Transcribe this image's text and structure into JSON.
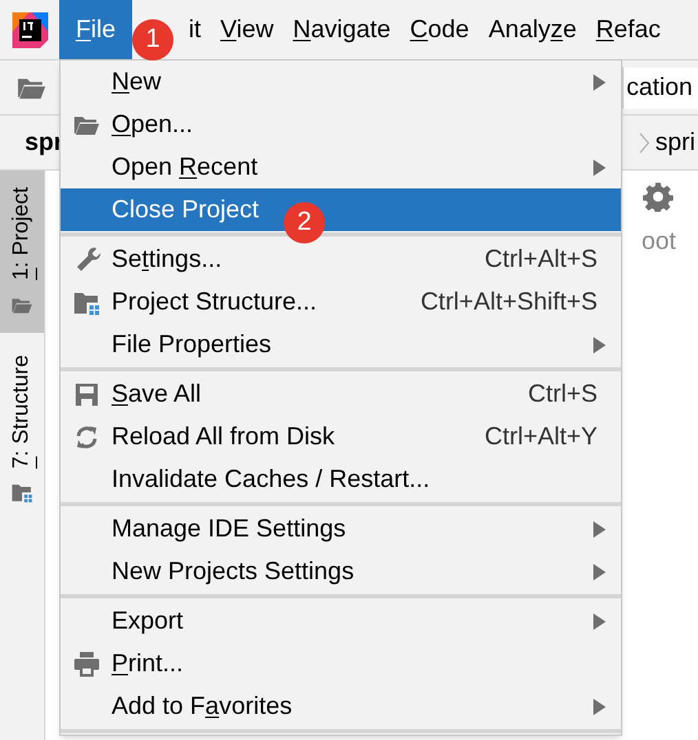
{
  "menu_bar": [
    {
      "label": {
        "key": "F",
        "after": "ile"
      },
      "selected": true
    },
    {
      "label": "it",
      "selected": false
    },
    {
      "label": {
        "key": "V",
        "after": "iew"
      },
      "selected": false
    },
    {
      "label": {
        "key": "N",
        "after": "avigate"
      },
      "selected": false
    },
    {
      "label": {
        "key": "C",
        "after": "ode"
      },
      "selected": false
    },
    {
      "label": {
        "before": "Analy",
        "key": "z",
        "after": "e"
      },
      "selected": false
    },
    {
      "label": {
        "key": "R",
        "after": "efac"
      },
      "selected": false
    }
  ],
  "toolbar": {
    "field_value": "cation"
  },
  "navigation_bar": {
    "project": "spr",
    "breadcrumb": "spri"
  },
  "tool_window_tabs": [
    {
      "label": {
        "key": "1",
        "after": ": Project"
      },
      "selected": true
    },
    {
      "label": {
        "key": "7",
        "after": ": Structure"
      },
      "selected": false
    }
  ],
  "editor": {
    "text": "oot"
  },
  "file_menu": [
    {
      "kind": "plain",
      "label": {
        "key": "N",
        "after": "ew"
      },
      "has_submenu": true,
      "selected": false
    },
    {
      "kind": "folder",
      "label": {
        "key": "O",
        "after": "pen..."
      },
      "has_submenu": false,
      "selected": false
    },
    {
      "kind": "plain",
      "label": {
        "before": "Open ",
        "key": "R",
        "after": "ecent"
      },
      "has_submenu": true,
      "selected": false
    },
    {
      "kind": "plain",
      "label": "Close Project",
      "has_submenu": false,
      "selected": true
    },
    {
      "kind": "separator"
    },
    {
      "kind": "wrench",
      "label": {
        "before": "Se",
        "key": "t",
        "after": "tings..."
      },
      "shortcut": "Ctrl+Alt+S",
      "has_submenu": false,
      "selected": false
    },
    {
      "kind": "structure",
      "label": "Project Structure...",
      "shortcut": "Ctrl+Alt+Shift+S",
      "has_submenu": false,
      "selected": false
    },
    {
      "kind": "plain",
      "label": "File Properties",
      "has_submenu": true,
      "selected": false
    },
    {
      "kind": "separator"
    },
    {
      "kind": "save",
      "label": {
        "key": "S",
        "after": "ave All"
      },
      "shortcut": "Ctrl+S",
      "has_submenu": false,
      "selected": false
    },
    {
      "kind": "reload",
      "label": "Reload All from Disk",
      "shortcut": "Ctrl+Alt+Y",
      "has_submenu": false,
      "selected": false
    },
    {
      "kind": "plain",
      "label": "Invalidate Caches / Restart...",
      "has_submenu": false,
      "selected": false
    },
    {
      "kind": "separator"
    },
    {
      "kind": "plain",
      "label": "Manage IDE Settings",
      "has_submenu": true,
      "selected": false
    },
    {
      "kind": "plain",
      "label": "New Projects Settings",
      "has_submenu": true,
      "selected": false
    },
    {
      "kind": "separator"
    },
    {
      "kind": "plain",
      "label": "Export",
      "has_submenu": true,
      "selected": false
    },
    {
      "kind": "printer",
      "label": {
        "key": "P",
        "after": "rint..."
      },
      "has_submenu": false,
      "selected": false
    },
    {
      "kind": "plain",
      "label": {
        "before": "Add to F",
        "key": "a",
        "after": "vorites"
      },
      "has_submenu": true,
      "selected": false
    },
    {
      "kind": "separator"
    }
  ],
  "annotations": [
    {
      "text": "1"
    },
    {
      "text": "2"
    }
  ]
}
